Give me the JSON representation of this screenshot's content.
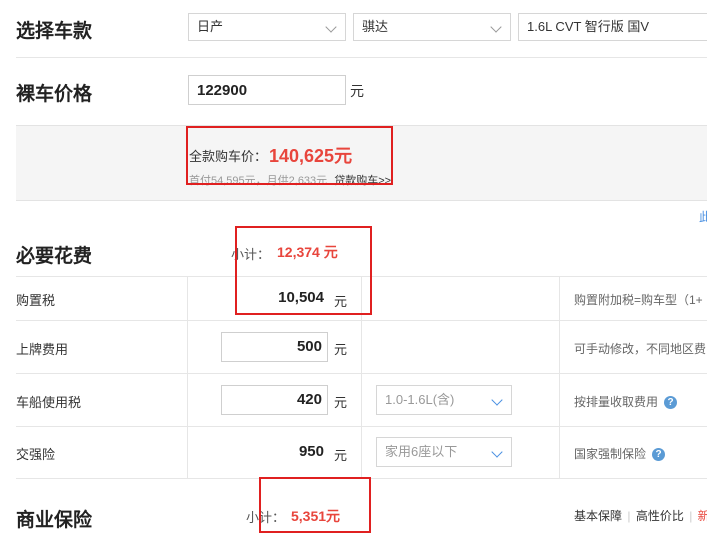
{
  "car_selection": {
    "title": "选择车款",
    "brand": "日产",
    "model": "骐达",
    "trim": "1.6L CVT 智行版 国V"
  },
  "bare_price": {
    "title": "裸车价格",
    "value": "122900",
    "unit": "元"
  },
  "summary": {
    "full_label": "全款购车价：",
    "full_value": "140,625元",
    "loan_text": "首付54,595元，月供2,633元",
    "loan_link": "贷款购车>>"
  },
  "side_link": "此",
  "necessary": {
    "title": "必要花费",
    "subtotal_label": "小计：",
    "subtotal_value": "12,374 元",
    "rows": [
      {
        "label": "购置税",
        "value": "10,504",
        "unit": "元",
        "note": "购置附加税=购车型（1+"
      },
      {
        "label": "上牌费用",
        "value": "500",
        "unit": "元",
        "note": "可手动修改，不同地区费"
      },
      {
        "label": "车船使用税",
        "value": "420",
        "unit": "元",
        "option": "1.0-1.6L(含)",
        "note": "按排量收取费用"
      },
      {
        "label": "交强险",
        "value": "950",
        "unit": "元",
        "option": "家用6座以下",
        "note": "国家强制保险"
      }
    ]
  },
  "insurance": {
    "title": "商业保险",
    "subtotal_label": "小计：",
    "subtotal_value": "5,351元",
    "plans": [
      "基本保障",
      "高性价比",
      "新手"
    ]
  },
  "icons": {
    "help": "question-circle-icon",
    "dropdown": "chevron-down-icon"
  },
  "colors": {
    "highlight": "#e8453c",
    "annotation": "#e02020",
    "help_icon": "#5b9bd5"
  }
}
